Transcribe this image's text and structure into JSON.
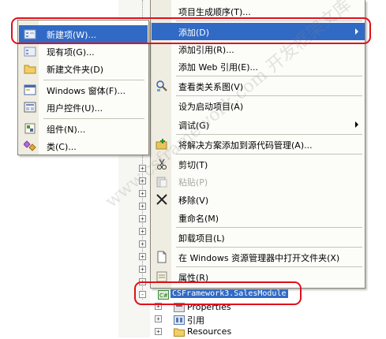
{
  "main_menu": {
    "items": [
      {
        "label": "项目生成顺序(T)..."
      },
      {
        "label": "添加(D)"
      },
      {
        "label": "添加引用(R)..."
      },
      {
        "label": "添加 Web 引用(E)..."
      },
      {
        "label": "查看类关系图(V)"
      },
      {
        "label": "设为启动项目(A)"
      },
      {
        "label": "调试(G)"
      },
      {
        "label": "将解决方案添加到源代码管理(A)..."
      },
      {
        "label": "剪切(T)"
      },
      {
        "label": "粘贴(P)"
      },
      {
        "label": "移除(V)"
      },
      {
        "label": "重命名(M)"
      },
      {
        "label": "卸载项目(L)"
      },
      {
        "label": "在 Windows 资源管理器中打开文件夹(X)"
      },
      {
        "label": "属性(R)"
      }
    ]
  },
  "sub_menu": {
    "items": [
      {
        "label": "新建项(W)..."
      },
      {
        "label": "现有项(G)..."
      },
      {
        "label": "新建文件夹(D)"
      },
      {
        "label": "Windows 窗体(F)..."
      },
      {
        "label": "用户控件(U)..."
      },
      {
        "label": "组件(N)..."
      },
      {
        "label": "类(C)..."
      }
    ]
  },
  "tree": {
    "project": "CSFramework3.SalesModule",
    "properties": "Properties",
    "references": "引用",
    "resources": "Resources"
  },
  "watermark": "www.csframework.com 开发框架文库",
  "colors": {
    "highlight": "#316ac5",
    "annotation": "#e0101a"
  }
}
